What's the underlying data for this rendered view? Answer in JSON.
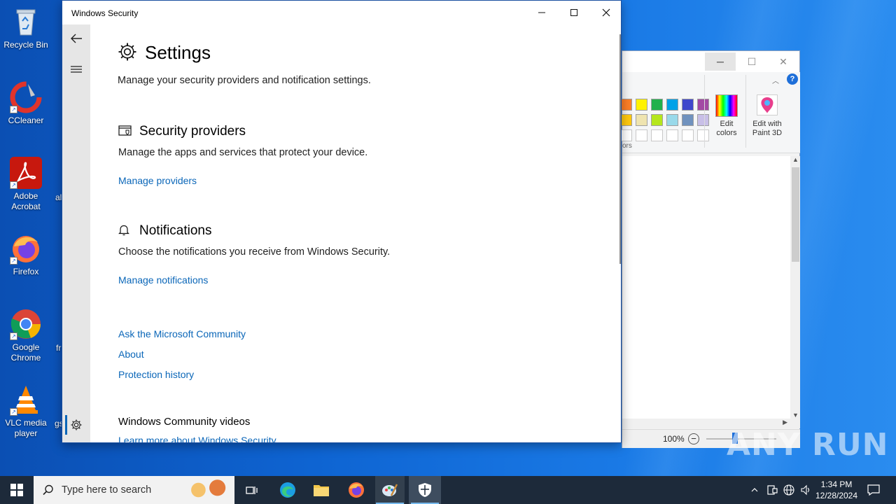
{
  "desktop": {
    "icons": [
      {
        "label": "Recycle Bin",
        "icon": "recycle-bin-icon"
      },
      {
        "label": "CCleaner",
        "icon": "ccleaner-icon"
      },
      {
        "label": "Adobe Acrobat",
        "icon": "adobe-acrobat-icon"
      },
      {
        "label": "Firefox",
        "icon": "firefox-icon"
      },
      {
        "label": "Google Chrome",
        "icon": "chrome-icon"
      },
      {
        "label": "VLC media player",
        "icon": "vlc-icon"
      }
    ],
    "peek_labels": [
      "al",
      "fr",
      "gs"
    ]
  },
  "paint": {
    "ribbon": {
      "edit_colors": "Edit colors",
      "edit_paint3d": "Edit with Paint 3D",
      "colors_group_partial": "ors"
    },
    "swatches_row1": [
      "#ff7f27",
      "#fff200",
      "#22b14c",
      "#00a2e8",
      "#3f48cc",
      "#a349a4"
    ],
    "swatches_row2": [
      "#ffc90e",
      "#efe4b0",
      "#b5e61d",
      "#99d9ea",
      "#7092be",
      "#c8bfe7"
    ],
    "zoom": "100%"
  },
  "security": {
    "window_title": "Windows Security",
    "page_title": "Settings",
    "page_desc": "Manage your security providers and notification settings.",
    "providers": {
      "title": "Security providers",
      "desc": "Manage the apps and services that protect your device.",
      "link": "Manage providers"
    },
    "notifications": {
      "title": "Notifications",
      "desc": "Choose the notifications you receive from Windows Security.",
      "link": "Manage notifications"
    },
    "links": [
      "Ask the Microsoft Community",
      "About",
      "Protection history"
    ],
    "videos": {
      "title": "Windows Community videos",
      "link": "Learn more about Windows Security"
    }
  },
  "taskbar": {
    "search_placeholder": "Type here to search",
    "time": "1:34 PM",
    "date": "12/28/2024"
  },
  "watermark": "ANY RUN",
  "colors": {
    "link": "#0a66b8",
    "taskbar": "#1d2a3a",
    "accent": "#0a5fc8"
  }
}
